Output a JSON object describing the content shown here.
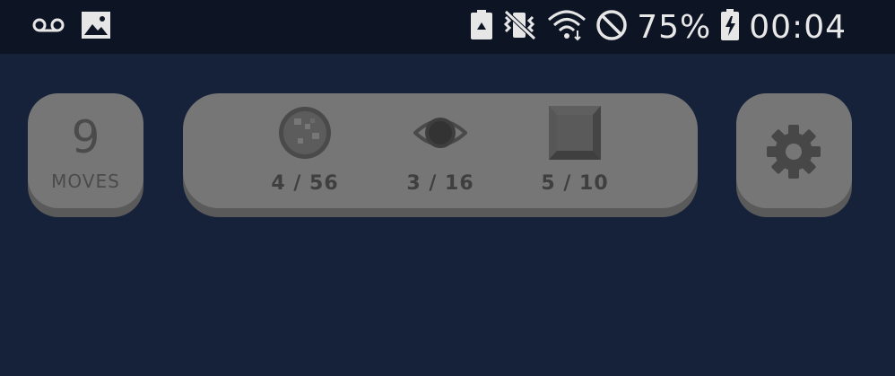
{
  "status_bar": {
    "icons_left": [
      "voicemail-icon",
      "image-icon"
    ],
    "icons_right": [
      "battery-saver-icon",
      "vibrate-icon",
      "wifi-icon",
      "do-not-disturb-icon"
    ],
    "battery_percent": "75%",
    "time": "00:04",
    "text_color": "#e8e8e8",
    "background": "#0d1424"
  },
  "hud": {
    "moves": {
      "value": "9",
      "label": "MOVES"
    },
    "goals": [
      {
        "icon": "cookie-icon",
        "count": "4 / 56"
      },
      {
        "icon": "eye-orb-icon",
        "count": "3 / 16"
      },
      {
        "icon": "square-block-icon",
        "count": "5 / 10"
      }
    ],
    "settings": {
      "icon": "gear-icon"
    },
    "panel_color": "#767676",
    "panel_shadow": "#5a5a5a",
    "text_color": "#4b4b4b"
  },
  "background": "#16223a"
}
